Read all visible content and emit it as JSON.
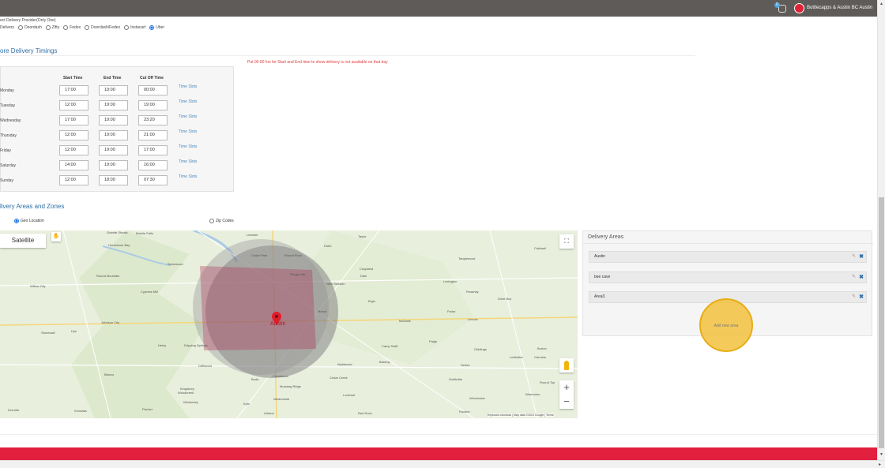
{
  "topbar": {
    "notification_count": "0",
    "brand_name": "Bottlecapps & Austin BC Austin"
  },
  "provider": {
    "title": "ect Delivery Provider(Only One)",
    "options": [
      "Delivery",
      "Doordash",
      "Zifty",
      "Fedex",
      "Doordash/Fedex",
      "Instacart",
      "Uber"
    ],
    "selected": "Uber"
  },
  "timings": {
    "title": "ore Delivery Timings",
    "hint": "Put 00:00 hrs for Start and End time to show delivery is not available on that day",
    "headers": {
      "start": "Start Time",
      "end": "End Time",
      "cutoff": "Cut Off Time"
    },
    "slot_label": "Time Slots",
    "days": [
      {
        "day": "Monday",
        "start": "17:00",
        "end": "19:00",
        "cutoff": "00:00"
      },
      {
        "day": "Tuesday",
        "start": "12:00",
        "end": "19:00",
        "cutoff": "19:00"
      },
      {
        "day": "Wednesday",
        "start": "17:00",
        "end": "19:00",
        "cutoff": "23:20"
      },
      {
        "day": "Thursday",
        "start": "12:00",
        "end": "19:00",
        "cutoff": "21:00"
      },
      {
        "day": "Friday",
        "start": "12:00",
        "end": "19:00",
        "cutoff": "17:00"
      },
      {
        "day": "Saturday",
        "start": "14:00",
        "end": "19:00",
        "cutoff": "16:00"
      },
      {
        "day": "Sunday",
        "start": "12:00",
        "end": "18:00",
        "cutoff": "07:30"
      }
    ]
  },
  "zones": {
    "title": "livery Areas and Zones",
    "geo_label": "Geo Location",
    "zip_label": "Zip Codes",
    "selected": "Geo Location"
  },
  "map": {
    "satellite_label": "Satellite",
    "city_label": "Austin",
    "footer": "Keyboard shortcuts | Map data ©2024 Google | Terms",
    "labels": [
      "Marble Falls",
      "Granite Shoals",
      "Horseshoe Bay",
      "Spicewood",
      "Cypress Mill",
      "Round Mountain",
      "Willow City",
      "Johnson City",
      "Stonewall",
      "Hye",
      "Henly",
      "Dripping Springs",
      "Driftwood",
      "Blanco",
      "Kendalia",
      "Fischer",
      "Woodcreek",
      "Wimberley",
      "Kyle",
      "Buda",
      "Uhland",
      "Niederwald",
      "Creedmoor",
      "Mustang Ridge",
      "Leander",
      "Cedar Park",
      "Round Rock",
      "Hutto",
      "Taylor",
      "Coupland",
      "New Sweden",
      "Elgin",
      "McDade",
      "Manor",
      "Pflugerville",
      "Bastrop",
      "Cedar Creek",
      "Wyldwood",
      "Camp Swift",
      "Paige",
      "Red Rock",
      "Lockhart",
      "Dale",
      "Rockne",
      "Smithville",
      "Giddings",
      "Lexington",
      "Tanglewood",
      "Caldwell",
      "Burton",
      "Ledbetter",
      "Carmine",
      "Winchester",
      "Warrenton",
      "Round Top",
      "Serbin",
      "Fedor",
      "Lincoln",
      "Dime Box",
      "Rosanky",
      "Kingsbury",
      "Kerrville"
    ]
  },
  "areas": {
    "title": "Delivery Areas",
    "items": [
      "Austin",
      "bee cave",
      "Area3"
    ],
    "add_label": "Add new area"
  },
  "colors": {
    "topbar": "#5f5b58",
    "accent_red": "#e21f3d",
    "link_blue": "#2d6ea7",
    "highlight": "#f2c13e"
  }
}
